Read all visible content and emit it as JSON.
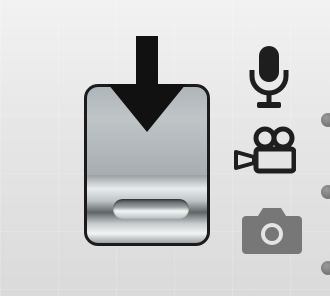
{
  "camera_mode_switch": {
    "selected_mode": "photo",
    "modes": [
      {
        "id": "audio",
        "icon": "microphone-icon",
        "active": true
      },
      {
        "id": "video",
        "icon": "video-camera-icon",
        "active": true
      },
      {
        "id": "photo",
        "icon": "camera-icon",
        "active": false
      }
    ],
    "direction_hint_icon": "arrow-down-icon"
  },
  "colors": {
    "background": "#e6e6e6",
    "icon_active": "#1e1e1e",
    "icon_inactive": "#777777",
    "switch_outline": "#1b1b1b",
    "indicator_dot": "#7a7a7a"
  }
}
